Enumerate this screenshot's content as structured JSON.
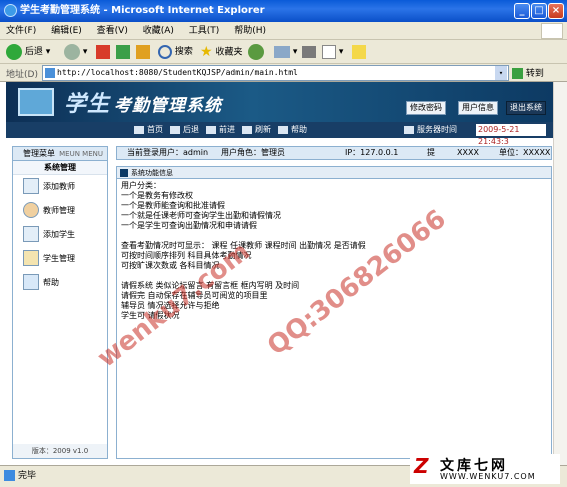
{
  "window": {
    "title": "学生考勤管理系统 - Microsoft Internet Explorer"
  },
  "menu": [
    "文件(F)",
    "编辑(E)",
    "查看(V)",
    "收藏(A)",
    "工具(T)",
    "帮助(H)"
  ],
  "toolbar": {
    "back": "后退",
    "search": "搜索",
    "favorites": "收藏夹"
  },
  "address": {
    "label": "地址(D)",
    "url": "http://localhost:8080/StudentKQJSP/admin/main.html",
    "go": "转到"
  },
  "banner": {
    "logo_1": "学生",
    "logo_2": "考勤管理系统",
    "btn_password": "修改密码",
    "btn_userinfo": "用户信息",
    "btn_logout": "退出系统"
  },
  "nav": {
    "home": "首页",
    "back": "后退",
    "forward": "前进",
    "refresh": "刷新",
    "help": "帮助",
    "server_label": "服务器时间",
    "server_time": "2009-5-21 21:43:3"
  },
  "sidebar": {
    "title": "管理菜单",
    "title_en": "MEUN MENU",
    "section": "系统管理",
    "items": [
      "添加教师",
      "教师管理",
      "添加学生",
      "学生管理",
      "帮助"
    ],
    "version": "版本：2009 v1.0"
  },
  "info": {
    "login_user": "当前登录用户：admin",
    "role": "用户角色：管理员",
    "ip": "IP：127.0.0.1",
    "tip": "提",
    "xxx": "XXXX",
    "unit": "单位：XXXXX"
  },
  "panel": {
    "title": "系统功能信息",
    "lines_1": [
      "用户分类：",
      "一个是教务有修改权",
      "一个是教师能查询和批准请假",
      "一个就是任课老师可查询学生出勤和请假情况",
      "一个是学生可查询出勤情况和申请请假"
    ],
    "lines_2": [
      "查看考勤情况时可显示：  课程  任课教师  课程时间  出勤情况  是否请假",
      "可按时间顺序排列  科目具体考勤情况",
      "可按旷课次数或  各科目情况"
    ],
    "lines_3": [
      "请假系统  类似论坛留言  有留言框  框内写明  及时间",
      "请假完  自动保存在辅导员可阅览的项目里",
      "辅导员  情况选择允许与拒绝",
      "学生可  请假状况"
    ]
  },
  "status": {
    "text": "完毕"
  },
  "watermark": {
    "w1": "wenku7.com",
    "w2": "QQ:306826066"
  },
  "corner_logo": {
    "title": "文库七网",
    "url": "WWW.WENKU7.COM"
  }
}
